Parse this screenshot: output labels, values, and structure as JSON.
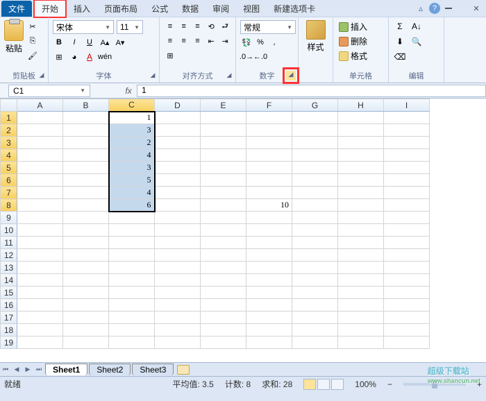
{
  "menu": {
    "file": "文件",
    "home": "开始",
    "insert": "插入",
    "page_layout": "页面布局",
    "formulas": "公式",
    "data": "数据",
    "review": "审阅",
    "view": "视图",
    "new_tab": "新建选项卡"
  },
  "ribbon": {
    "clipboard": {
      "label": "剪贴板",
      "paste": "粘贴"
    },
    "font": {
      "label": "字体",
      "name": "宋体",
      "size": "11",
      "bold": "B",
      "italic": "I",
      "underline": "U"
    },
    "alignment": {
      "label": "对齐方式"
    },
    "number": {
      "label": "数字",
      "format": "常规",
      "percent": "%",
      "comma": ","
    },
    "styles": {
      "label": "",
      "btn": "样式"
    },
    "cells": {
      "label": "单元格",
      "insert": "插入",
      "delete": "删除",
      "format": "格式"
    },
    "editing": {
      "label": "编辑",
      "sigma": "Σ"
    }
  },
  "formula_bar": {
    "name_box": "C1",
    "fx": "fx",
    "value": "1"
  },
  "columns": [
    "A",
    "B",
    "C",
    "D",
    "E",
    "F",
    "G",
    "H",
    "I"
  ],
  "rows": [
    1,
    2,
    3,
    4,
    5,
    6,
    7,
    8,
    9,
    10,
    11,
    12,
    13,
    14,
    15,
    16,
    17,
    18,
    19
  ],
  "cell_data": {
    "C1": "1",
    "C2": "3",
    "C3": "2",
    "C4": "4",
    "C5": "3",
    "C6": "5",
    "C7": "4",
    "C8": "6",
    "F8": "10"
  },
  "selection": {
    "range": "C1:C8",
    "active": "C1",
    "selected_rows": [
      1,
      2,
      3,
      4,
      5,
      6,
      7,
      8
    ],
    "selected_col": "C"
  },
  "sheets": {
    "s1": "Sheet1",
    "s2": "Sheet2",
    "s3": "Sheet3",
    "active": 0
  },
  "status": {
    "ready": "就绪",
    "avg_label": "平均值:",
    "avg": "3.5",
    "count_label": "计数:",
    "count": "8",
    "sum_label": "求和:",
    "sum": "28",
    "zoom": "100%"
  },
  "watermark": {
    "line1": "超级下载站",
    "line2": "www.shancun.net"
  }
}
